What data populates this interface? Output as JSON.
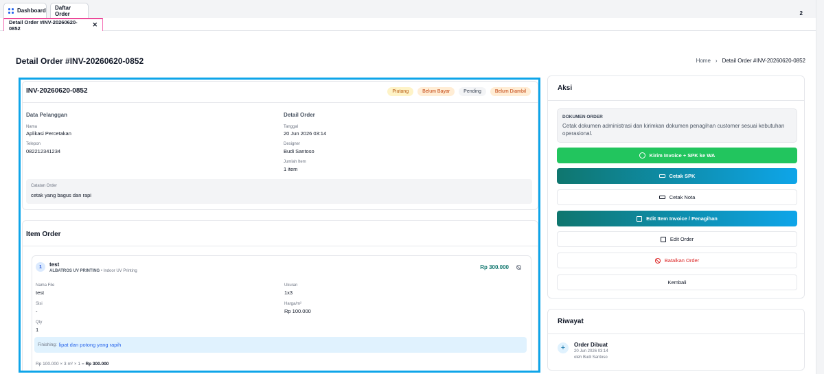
{
  "tabs": {
    "row1": [
      {
        "label": "Dashboard",
        "icon": "grid-icon"
      },
      {
        "label": "Daftar Order"
      }
    ],
    "count": "2",
    "active": {
      "label": "Detail Order #INV-20260620-0852",
      "close": "✕"
    }
  },
  "page": {
    "title": "Detail Order #INV-20260620-0852",
    "breadcrumb": {
      "home": "Home",
      "separator": "›",
      "current": "Detail Order #INV-20260620-0852"
    }
  },
  "order": {
    "invoice": "INV-20260620-0852",
    "badges": [
      "Piutang",
      "Belum Bayar",
      "Pending",
      "Belum Diambil"
    ],
    "customer": {
      "heading": "Data Pelanggan",
      "name_label": "Nama",
      "name": "Aplikasi Percetakan",
      "phone_label": "Telepon",
      "phone": "082212341234"
    },
    "detail": {
      "heading": "Detail Order",
      "date_label": "Tanggal",
      "date": "20 Jun 2026 03:14",
      "designer_label": "Designer",
      "designer": "Budi Santoso",
      "qty_label": "Jumlah Item",
      "qty": "1 item"
    },
    "note": {
      "label": "Catatan Order",
      "text": "cetak yang bagus dan rapi"
    }
  },
  "items": {
    "title": "Item Order",
    "list": [
      {
        "number": "1",
        "name": "test",
        "vendor": "ALBATROS UV PRINTING",
        "category": " • Indoor UV Printing",
        "price": "Rp 300.000",
        "file_label": "Nama File",
        "file": "test",
        "size_label": "Ukuran",
        "size": "1x3",
        "sides_label": "Sisi",
        "sides": "-",
        "rate_label": "Harga/m²",
        "rate": "Rp 100.000",
        "qty_label": "Qty",
        "qty": "1",
        "finishing_label": "Finishing:",
        "finishing": "lipat dan potong yang rapih",
        "calc": "Rp 100.000 × 3 m² × 1 = ",
        "calc_total": "Rp 300.000"
      }
    ]
  },
  "aksi": {
    "title": "Aksi",
    "doc_heading": "DOKUMEN ORDER",
    "doc_text": "Cetak dokumen administrasi dan kirimkan dokumen penagihan customer sesuai kebutuhan operasional.",
    "buttons": {
      "wa": "Kirim Invoice + SPK ke WA",
      "spk": "Cetak SPK",
      "nota": "Cetak Nota",
      "edit_invoice": "Edit Item Invoice / Penagihan",
      "edit_order": "Edit Order",
      "cancel": "Batalkan Order",
      "back": "Kembali"
    }
  },
  "riwayat": {
    "title": "Riwayat",
    "events": [
      {
        "title": "Order Dibuat",
        "date": "20 Jun 2026 03:14",
        "by": "oleh Budi Santoso"
      }
    ]
  },
  "colors": {
    "accent": "#0ea5e9",
    "whatsapp": "#22c55e",
    "teal": "#0f766e",
    "danger": "#dc2626"
  }
}
